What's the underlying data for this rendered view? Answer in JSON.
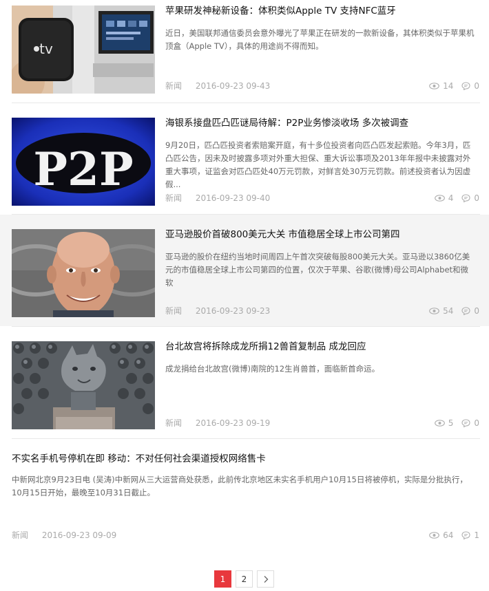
{
  "articles": [
    {
      "title": "苹果研发神秘新设备：体积类似Apple TV 支持NFC蓝牙",
      "summary": "近日，美国联邦通信委员会意外曝光了苹果正在研发的一款新设备，其体积类似于苹果机顶盒（Apple TV），具体的用途尚不得而知。",
      "category": "新闻",
      "date": "2016-09-23 09-43",
      "views": "14",
      "comments": "0",
      "thumb_text": "tv"
    },
    {
      "title": "海银系接盘匹凸匹谜局待解：P2P业务惨淡收场 多次被调查",
      "summary": "9月20日，匹凸匹投资者索赔案开庭，有十多位投资者向匹凸匹发起索赔。今年3月，匹凸匹公告，因未及时披露多项对外重大担保、重大诉讼事项及2013年年报中未披露对外重大事项，证监会对匹凸匹处40万元罚款，对鲜言处30万元罚款。前述投资者认为因虚假...",
      "category": "新闻",
      "date": "2016-09-23 09-40",
      "views": "4",
      "comments": "0",
      "thumb_text": "P2P"
    },
    {
      "title": "亚马逊股价首破800美元大关 市值稳居全球上市公司第四",
      "summary": "亚马逊的股价在纽约当地时间周四上午首次突破每股800美元大关。亚马逊以3860亿美元的市值稳居全球上市公司第四的位置，仅次于苹果、谷歌(微博)母公司Alphabet和微软",
      "category": "新闻",
      "date": "2016-09-23 09-23",
      "views": "54",
      "comments": "0"
    },
    {
      "title": "台北故宫将拆除成龙所捐12兽首复制品 成龙回应",
      "summary": "成龙捐给台北故宫(微博)南院的12生肖兽首，面临新首命运。",
      "category": "新闻",
      "date": "2016-09-23 09-19",
      "views": "5",
      "comments": "0"
    },
    {
      "title": "不实名手机号停机在即 移动：不对任何社会渠道授权网络售卡",
      "summary": "中新网北京9月23日电 (吴涛)中新网从三大运营商处获悉，此前传北京地区未实名手机用户10月15日将被停机，实际是分批执行，10月15日开始，最晚至10月31日截止。",
      "category": "新闻",
      "date": "2016-09-23 09-09",
      "views": "64",
      "comments": "1"
    }
  ],
  "pagination": {
    "pages": [
      "1",
      "2"
    ],
    "next_icon": "chevron-right-icon",
    "active_color": "#e8383d"
  },
  "icons": {
    "views": "eye-icon",
    "comments": "comment-bubble-icon"
  }
}
